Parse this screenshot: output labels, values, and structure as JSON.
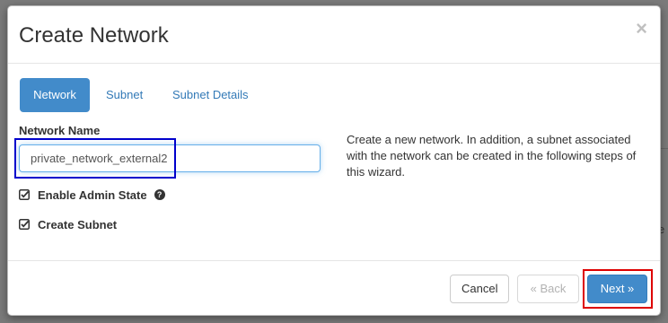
{
  "modal": {
    "title": "Create Network",
    "close_glyph": "×"
  },
  "tabs": [
    {
      "label": "Network",
      "active": true
    },
    {
      "label": "Subnet",
      "active": false
    },
    {
      "label": "Subnet Details",
      "active": false
    }
  ],
  "form": {
    "network_name_label": "Network Name",
    "network_name_value": "private_network_external2",
    "enable_admin_state_label": "Enable Admin State",
    "enable_admin_state_checked": true,
    "create_subnet_label": "Create Subnet",
    "create_subnet_checked": true,
    "help_glyph": "?"
  },
  "description": "Create a new network. In addition, a subnet associated with the network can be created in the following steps of this wizard.",
  "footer": {
    "cancel_label": "Cancel",
    "back_label": "« Back",
    "next_label": "Next »"
  },
  "colors": {
    "primary": "#428bca",
    "link": "#337ab7",
    "focus_annotation": "#0000cc",
    "next_annotation": "#dd0000"
  },
  "icons": {
    "close": "close-icon",
    "checkbox": "checkbox-checked-icon",
    "help": "question-circle-icon"
  }
}
